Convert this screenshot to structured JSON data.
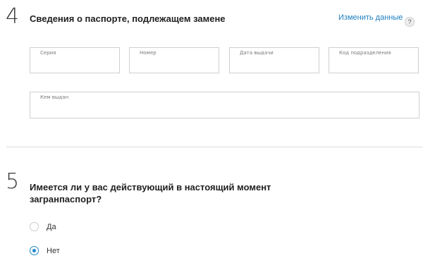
{
  "section4": {
    "number": "4",
    "title": "Сведения о паспорте, подлежащем замене",
    "change_link": "Изменить данные",
    "help_icon_glyph": "?",
    "fields": {
      "series": {
        "label": "Серия",
        "value": ""
      },
      "number": {
        "label": "Номер",
        "value": ""
      },
      "issue_date": {
        "label": "Дата выдачи",
        "value": ""
      },
      "division_code": {
        "label": "Код подразделения",
        "value": ""
      },
      "issued_by": {
        "label": "Кем выдан",
        "value": ""
      }
    }
  },
  "section5": {
    "number": "5",
    "title_line1": "Имеется ли у вас действующий в настоящий момент",
    "title_line2": "загранпаспорт?",
    "options": [
      {
        "label": "Да",
        "checked": false
      },
      {
        "label": "Нет",
        "checked": true
      }
    ]
  },
  "colors": {
    "accent": "#1e88c8",
    "link": "#1e7fbf",
    "border": "#cfcfcf"
  }
}
